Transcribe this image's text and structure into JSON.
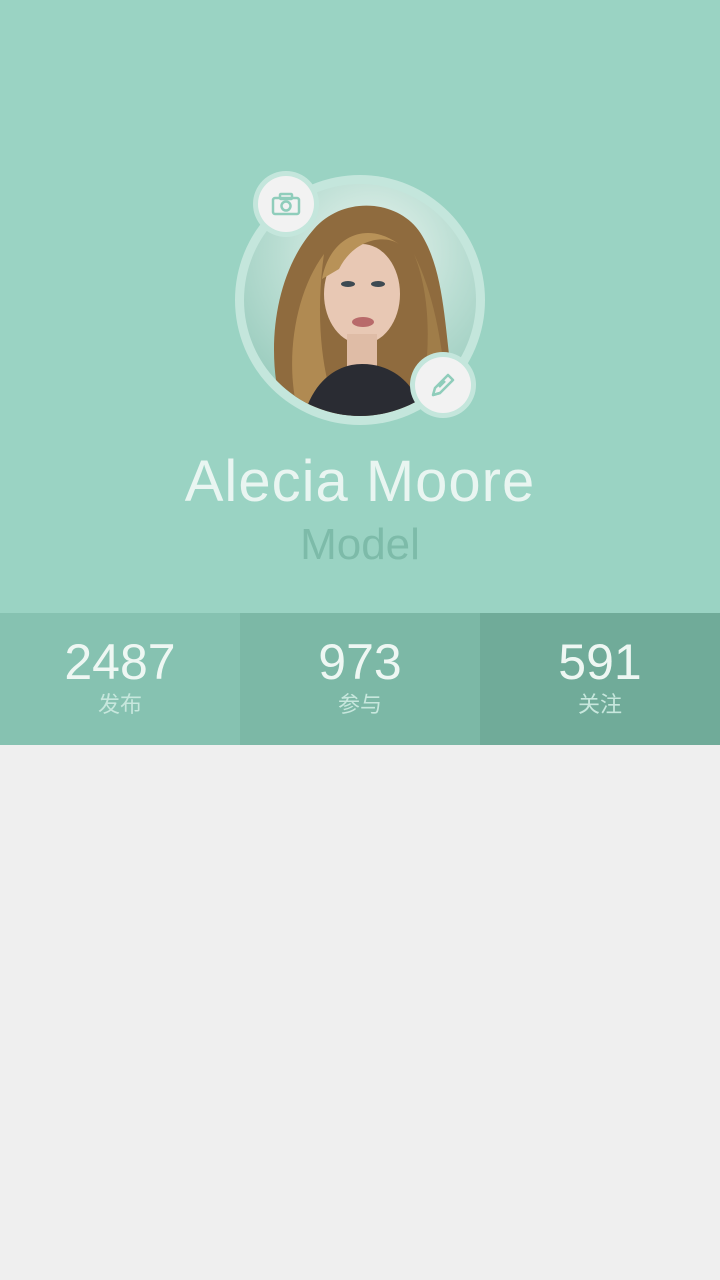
{
  "profile": {
    "name": "Alecia Moore",
    "role": "Model"
  },
  "icons": {
    "camera": "camera-icon",
    "edit": "edit-icon"
  },
  "stats": [
    {
      "value": "2487",
      "label": "发布"
    },
    {
      "value": "973",
      "label": "参与"
    },
    {
      "value": "591",
      "label": "关注"
    }
  ],
  "colors": {
    "header_bg": "#9ad3c3",
    "stat_1_bg": "#86c2b1",
    "stat_2_bg": "#7cb8a6",
    "stat_3_bg": "#70ab99",
    "page_bg": "#efefef"
  }
}
